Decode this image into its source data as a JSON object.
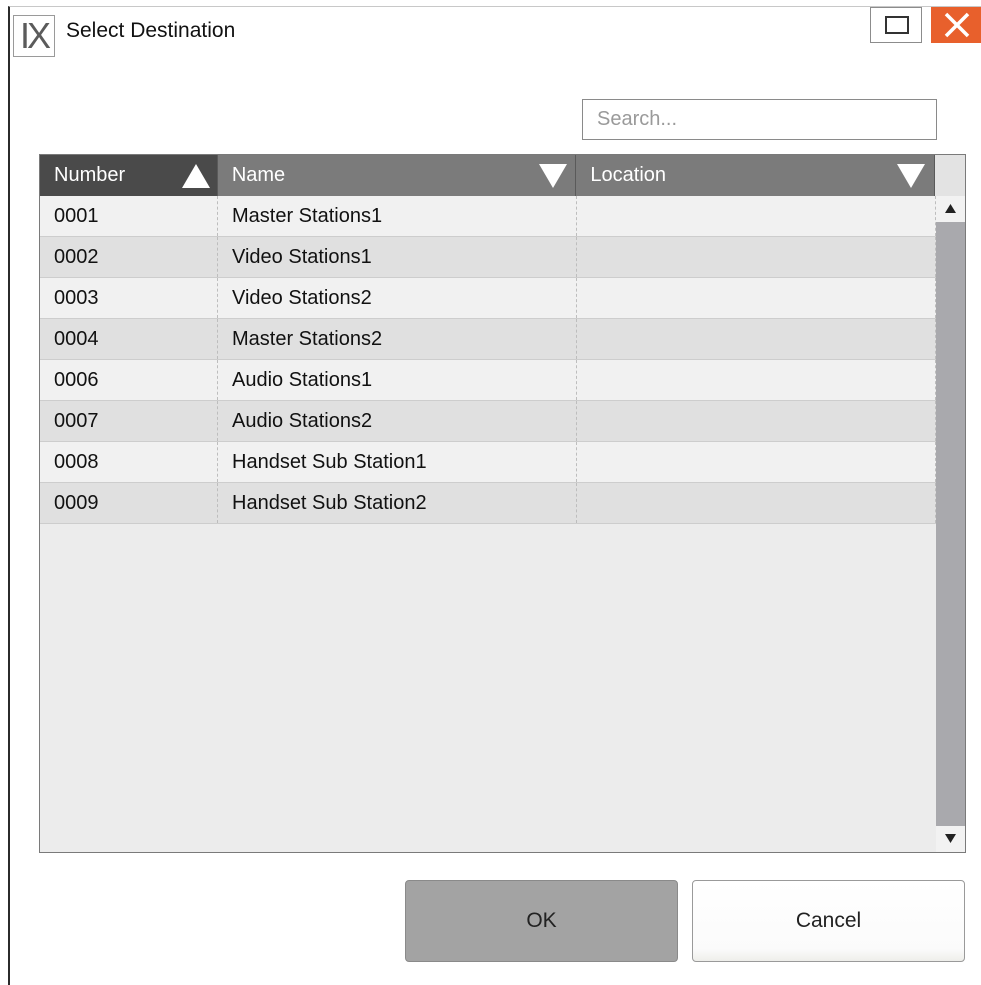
{
  "window": {
    "logo_text": "IX",
    "title": "Select Destination"
  },
  "search": {
    "placeholder": "Search...",
    "value": ""
  },
  "table": {
    "columns": [
      {
        "label": "Number",
        "sort": "ascending",
        "active": true
      },
      {
        "label": "Name",
        "sort": "descending",
        "active": false
      },
      {
        "label": "Location",
        "sort": "descending",
        "active": false
      }
    ],
    "rows": [
      {
        "number": "0001",
        "name": "Master Stations1",
        "location": ""
      },
      {
        "number": "0002",
        "name": "Video Stations1",
        "location": ""
      },
      {
        "number": "0003",
        "name": "Video Stations2",
        "location": ""
      },
      {
        "number": "0004",
        "name": "Master Stations2",
        "location": ""
      },
      {
        "number": "0006",
        "name": "Audio Stations1",
        "location": ""
      },
      {
        "number": "0007",
        "name": "Audio Stations2",
        "location": ""
      },
      {
        "number": "0008",
        "name": "Handset Sub Station1",
        "location": ""
      },
      {
        "number": "0009",
        "name": "Handset Sub Station2",
        "location": ""
      }
    ]
  },
  "buttons": {
    "ok": "OK",
    "cancel": "Cancel"
  },
  "colors": {
    "close_button": "#e8602c",
    "header_active": "#4a4a4a",
    "header": "#7b7b7b",
    "ok_button": "#a3a3a3"
  }
}
